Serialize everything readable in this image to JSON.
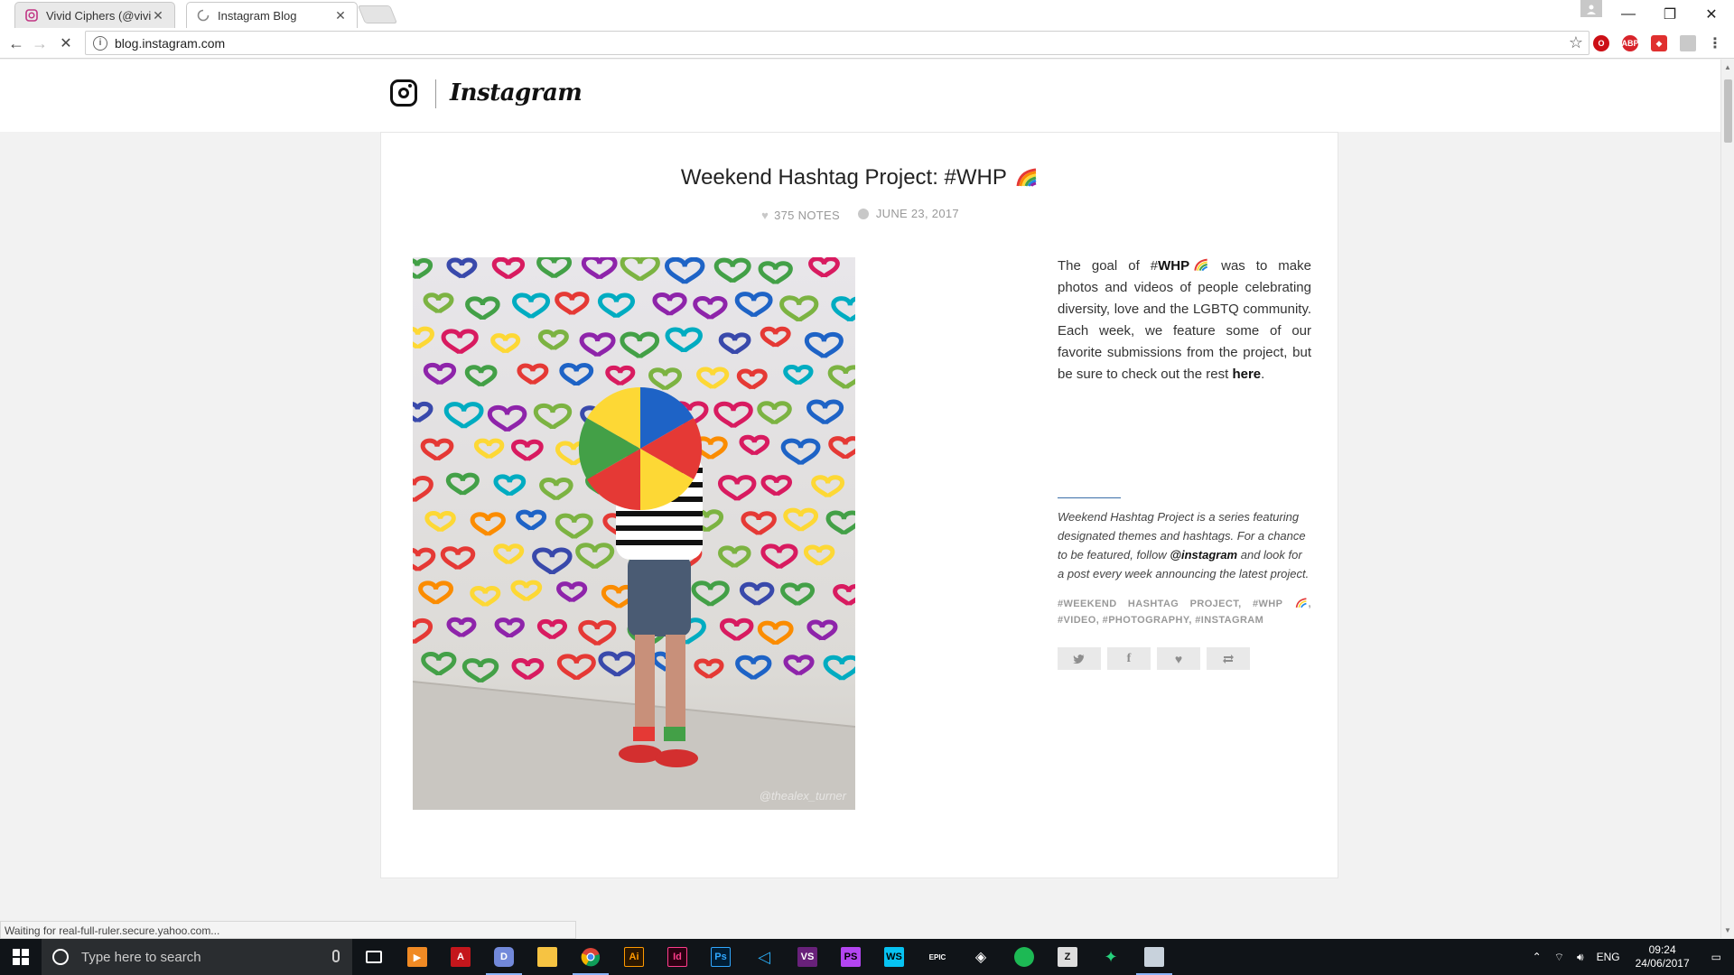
{
  "browser": {
    "tabs": [
      {
        "title": "Vivid Ciphers (@vividcip",
        "favicon": "instagram-icon",
        "active": false
      },
      {
        "title": "Instagram Blog",
        "favicon": "loading-spinner-icon",
        "active": true
      }
    ],
    "url": "blog.instagram.com",
    "status_text": "Waiting for real-full-ruler.secure.yahoo.com..."
  },
  "site": {
    "brand": "Instagram"
  },
  "post": {
    "title": "Weekend Hashtag Project: #WHP",
    "notes": "375 NOTES",
    "date": "JUNE 23, 2017",
    "image_watermark": "@thealex_turner",
    "body_intro": "The goal of #",
    "body_hashtag": "WHP",
    "body_rest": " was to make photos and videos of people celebrating diversity, love and the LGBTQ community. Each week, we feature some of our favorite submissions from the project, but be sure to check out the rest ",
    "body_link": "here",
    "body_end": ".",
    "series_intro": "Weekend Hashtag Project is a series featuring designated themes and hashtags. For a chance to be featured, follow ",
    "series_handle": "@instagram",
    "series_end": " and look for a post every week announcing the latest project.",
    "tags": [
      "#WEEKEND HASHTAG PROJECT",
      "#WHP",
      "#VIDEO",
      "#PHOTOGRAPHY",
      "#INSTAGRAM"
    ],
    "share_buttons": [
      "twitter-icon",
      "facebook-icon",
      "like-icon",
      "reblog-icon"
    ]
  },
  "taskbar": {
    "search_placeholder": "Type here to search",
    "apps": [
      "task-view-icon",
      "vlc-icon",
      "acrobat-icon",
      "discord-icon",
      "file-explorer-icon",
      "chrome-icon",
      "illustrator-icon",
      "indesign-icon",
      "photoshop-icon",
      "vscode-icon",
      "visual-studio-icon",
      "phpstorm-icon",
      "webstorm-icon",
      "epic-games-icon",
      "unity-icon",
      "spotify-icon",
      "zbrush-icon",
      "app-icon",
      "network-app-icon"
    ],
    "language": "ENG",
    "time": "09:24",
    "date": "24/06/2017"
  },
  "colors": {
    "taskbar": "#101418",
    "page_background": "#f2f2f2",
    "link_rule": "#3b6ea8",
    "meta_grey": "#999999"
  }
}
